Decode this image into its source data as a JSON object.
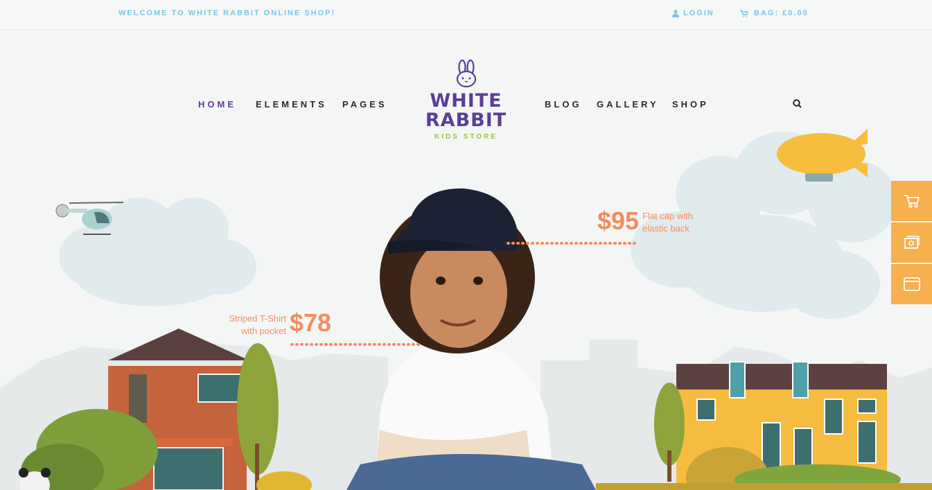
{
  "topbar": {
    "welcome": "WELCOME TO WHITE RABBIT ONLINE SHOP!",
    "login_icon": "user-icon",
    "login": "LOGIN",
    "bag_icon": "cart-icon",
    "bag": "BAG: £0.00"
  },
  "nav": {
    "left": [
      "HOME",
      "ELEMENTS",
      "PAGES"
    ],
    "right": [
      "BLOG",
      "GALLERY",
      "SHOP"
    ],
    "active": "HOME",
    "search_icon": "search-icon"
  },
  "logo": {
    "title_line1": "WHITE",
    "title_line2": "RABBIT",
    "subtitle": "KIDS STORE",
    "icon": "rabbit-icon"
  },
  "hero": {
    "item1": {
      "price": "$95",
      "desc_line1": "Flat cap with",
      "desc_line2": "elastic back"
    },
    "item2": {
      "price": "$78",
      "desc_line1": "Striped T-Shirt",
      "desc_line2": "with pocket"
    }
  },
  "sidebar": {
    "icons": [
      "cart-icon",
      "gallery-icon",
      "window-icon"
    ]
  },
  "colors": {
    "brand": "#5b3e96",
    "accent": "#f28d61",
    "top_link": "#7cc6e0",
    "sidebar": "#f6b04d",
    "logo_sub": "#99c23d"
  }
}
